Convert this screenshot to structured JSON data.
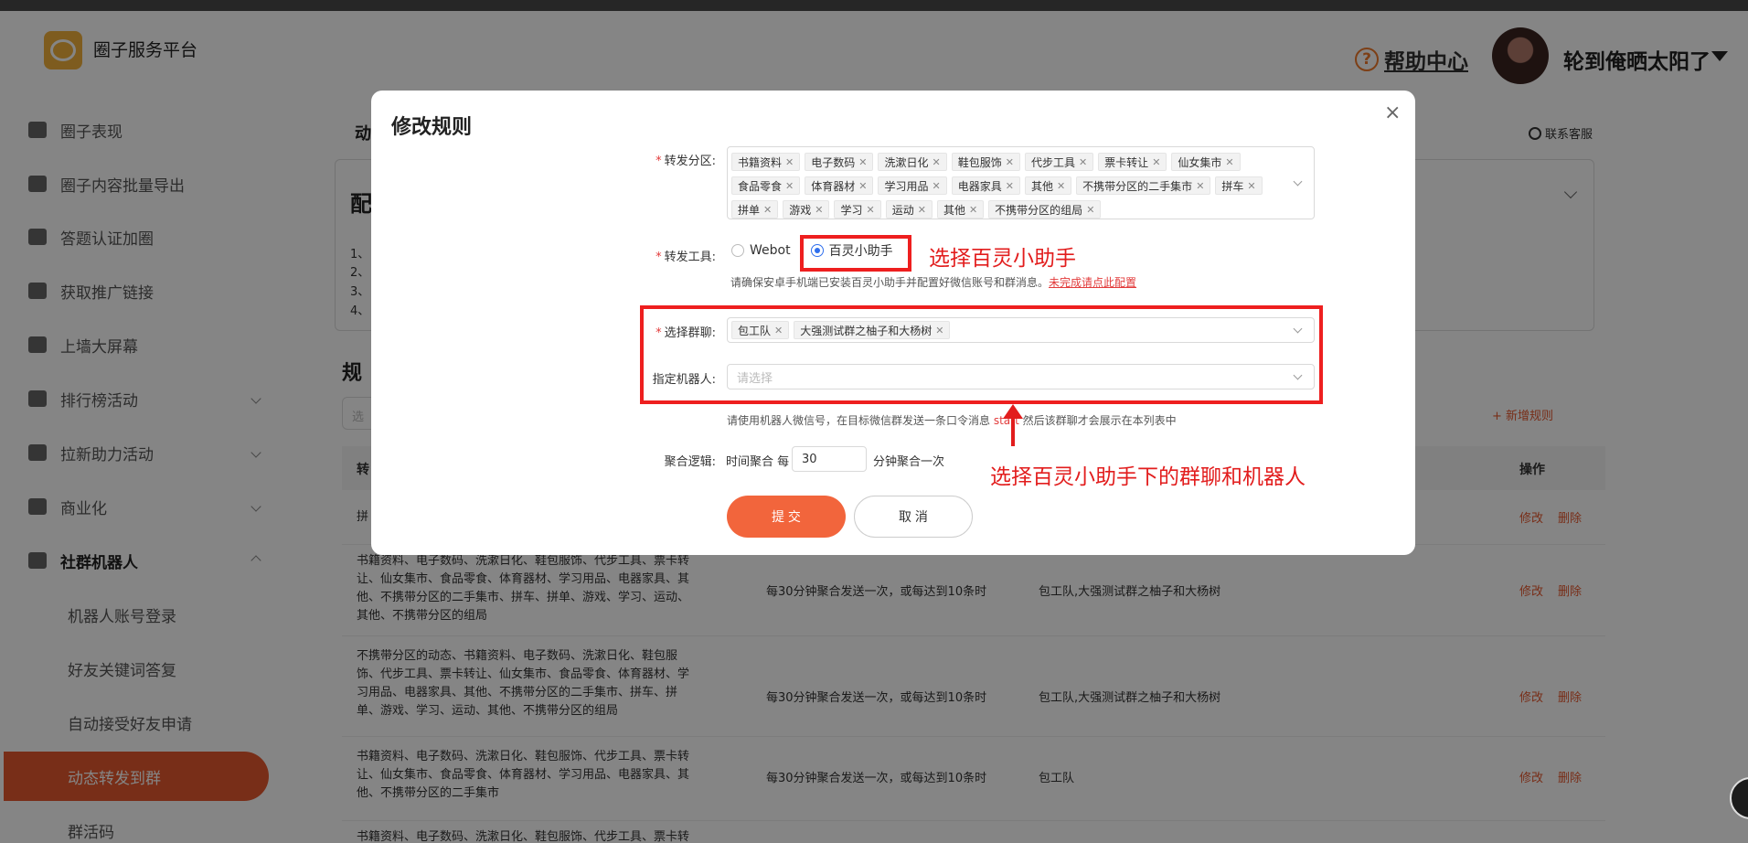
{
  "header": {
    "brand": "圈子服务平台",
    "help_icon": "?",
    "help_label": "帮助中心",
    "username": "轮到俺晒太阳了"
  },
  "sidebar": {
    "items": [
      {
        "label": "圈子表现",
        "icon": "bar-chart-icon"
      },
      {
        "label": "圈子内容批量导出",
        "icon": "cloud-download-icon"
      },
      {
        "label": "答题认证加圈",
        "icon": "user-check-icon"
      },
      {
        "label": "获取推广链接",
        "icon": "link-icon"
      },
      {
        "label": "上墙大屏幕",
        "icon": "monitor-icon"
      },
      {
        "label": "排行榜活动",
        "icon": "ranking-icon"
      },
      {
        "label": "拉新助力活动",
        "icon": "boost-icon"
      },
      {
        "label": "商业化",
        "icon": "commerce-icon"
      },
      {
        "label": "社群机器人",
        "icon": "robot-icon"
      }
    ],
    "sub_items": [
      {
        "label": "机器人账号登录"
      },
      {
        "label": "好友关键词答复"
      },
      {
        "label": "自动接受好友申请"
      },
      {
        "label": "动态转发到群"
      },
      {
        "label": "群活码"
      }
    ]
  },
  "main": {
    "title_fragment": "动",
    "contact_label": "联系客服",
    "config_title_fragment": "配",
    "config_lines": [
      "1、",
      "2、",
      "3、",
      "4、"
    ],
    "rules_title_fragment": "规",
    "search_placeholder_fragment": "选",
    "add_rule_label": "+ 新增规则",
    "table_headers": {
      "col1": "转",
      "action": "操作"
    },
    "rows": [
      {
        "desc": "拼",
        "agg": "",
        "group": "",
        "edit": "修改",
        "delete": "删除"
      },
      {
        "desc": "书籍资料、电子数码、洗漱日化、鞋包服饰、代步工具、票卡转让、仙女集市、食品零食、体育器材、学习用品、电器家具、其他、不携带分区的二手集市、拼车、拼单、游戏、学习、运动、其他、不携带分区的组局",
        "agg": "每30分钟聚合发送一次，或每达到10条时",
        "group": "包工队,大强测试群之柚子和大杨树",
        "edit": "修改",
        "delete": "删除"
      },
      {
        "desc": "不携带分区的动态、书籍资料、电子数码、洗漱日化、鞋包服饰、代步工具、票卡转让、仙女集市、食品零食、体育器材、学习用品、电器家具、其他、不携带分区的二手集市、拼车、拼单、游戏、学习、运动、其他、不携带分区的组局",
        "agg": "每30分钟聚合发送一次，或每达到10条时",
        "group": "包工队,大强测试群之柚子和大杨树",
        "edit": "修改",
        "delete": "删除"
      },
      {
        "desc": "书籍资料、电子数码、洗漱日化、鞋包服饰、代步工具、票卡转让、仙女集市、食品零食、体育器材、学习用品、电器家具、其他、不携带分区的二手集市",
        "agg": "每30分钟聚合发送一次，或每达到10条时",
        "group": "包工队",
        "edit": "修改",
        "delete": "删除"
      },
      {
        "desc": "书籍资料、电子数码、洗漱日化、鞋包服饰、代步工具、票卡转",
        "agg": "",
        "group": "",
        "edit": "",
        "delete": ""
      }
    ]
  },
  "modal": {
    "title": "修改规则",
    "close": "×",
    "forward_zones": {
      "label": "转发分区:",
      "tags": [
        "书籍资料",
        "电子数码",
        "洗漱日化",
        "鞋包服饰",
        "代步工具",
        "票卡转让",
        "仙女集市",
        "食品零食",
        "体育器材",
        "学习用品",
        "电器家具",
        "其他",
        "不携带分区的二手集市",
        "拼车",
        "拼单",
        "游戏",
        "学习",
        "运动",
        "其他",
        "不携带分区的组局"
      ]
    },
    "forward_tool": {
      "label": "转发工具:",
      "options": [
        "Webot",
        "百灵小助手"
      ],
      "selected": "百灵小助手",
      "hint": "请确保安卓手机端已安装百灵小助手并配置好微信账号和群消息。",
      "hint_link": "未完成请点此配置"
    },
    "select_group": {
      "label": "选择群聊:",
      "tags": [
        "包工队",
        "大强测试群之柚子和大杨树"
      ]
    },
    "robot": {
      "label": "指定机器人:",
      "placeholder": "请选择"
    },
    "group_hint": {
      "before": "请使用机器人微信号，在目标微信群发送一条口令消息",
      "keyword": "start",
      "after": "然后该群聊才会展示在本列表中"
    },
    "aggregate": {
      "label": "聚合逻辑:",
      "prefix": "时间聚合 每",
      "value": "30",
      "suffix": "分钟聚合一次"
    },
    "submit_label": "提 交",
    "cancel_label": "取 消"
  },
  "annotations": {
    "tool_note": "选择百灵小助手",
    "group_note": "选择百灵小助手下的群聊和机器人",
    "accent_color": "#ee1f1f"
  }
}
